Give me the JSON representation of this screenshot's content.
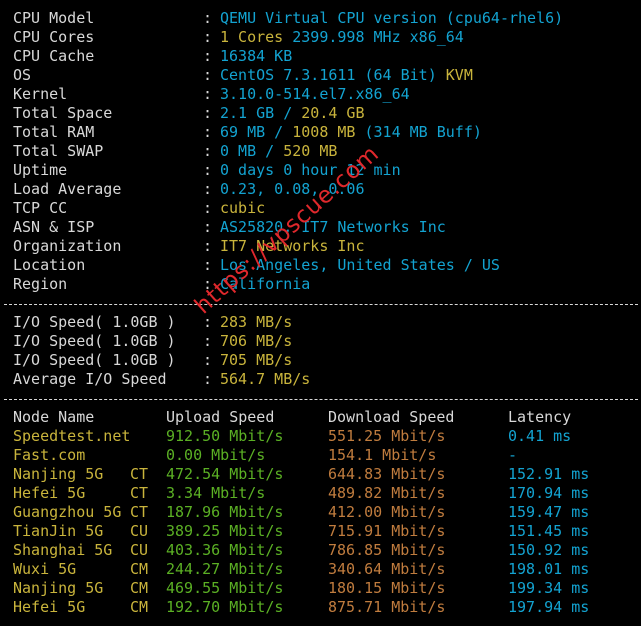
{
  "system": {
    "cpu_model": {
      "label": "CPU Model",
      "value": "QEMU Virtual CPU version (cpu64-rhel6)"
    },
    "cpu_cores": {
      "label": "CPU Cores",
      "count": "1 Cores",
      "freq": "2399.998 MHz x86_64"
    },
    "cpu_cache": {
      "label": "CPU Cache",
      "value": "16384 KB"
    },
    "os": {
      "label": "OS",
      "value": "CentOS 7.3.1611 (64 Bit)",
      "virt": "KVM"
    },
    "kernel": {
      "label": "Kernel",
      "value": "3.10.0-514.el7.x86_64"
    },
    "total_space": {
      "label": "Total Space",
      "used": "2.1 GB",
      "sep": " / ",
      "total": "20.4 GB"
    },
    "total_ram": {
      "label": "Total RAM",
      "used": "69 MB",
      "sep": " / ",
      "total": "1008 MB",
      "buff": "(314 MB Buff)"
    },
    "total_swap": {
      "label": "Total SWAP",
      "used": "0 MB",
      "sep": " / ",
      "total": "520 MB"
    },
    "uptime": {
      "label": "Uptime",
      "value": "0 days 0 hour 12 min"
    },
    "load_average": {
      "label": "Load Average",
      "value": "0.23, 0.08, 0.06"
    },
    "tcp_cc": {
      "label": "TCP CC",
      "value": "cubic"
    },
    "asn_isp": {
      "label": "ASN & ISP",
      "value": "AS25820, IT7 Networks Inc"
    },
    "organization": {
      "label": "Organization",
      "value": "IT7 Networks Inc"
    },
    "location": {
      "label": "Location",
      "value": "Los Angeles, United States / US"
    },
    "region": {
      "label": "Region",
      "value": "California"
    }
  },
  "colon": ":",
  "separator": "----------------------------------------------------------------------",
  "io": {
    "runs": [
      {
        "label": "I/O Speed( 1.0GB )",
        "value": "283 MB/s"
      },
      {
        "label": "I/O Speed( 1.0GB )",
        "value": "706 MB/s"
      },
      {
        "label": "I/O Speed( 1.0GB )",
        "value": "705 MB/s"
      }
    ],
    "average": {
      "label": "Average I/O Speed",
      "value": "564.7 MB/s"
    }
  },
  "speedtest": {
    "headers": {
      "node": "Node Name",
      "upload": "Upload Speed",
      "download": "Download Speed",
      "latency": "Latency"
    },
    "rows": [
      {
        "node": "Speedtest.net",
        "isp": "",
        "upload": "912.50 Mbit/s",
        "download": "551.25 Mbit/s",
        "latency": "0.41 ms"
      },
      {
        "node": "Fast.com",
        "isp": "",
        "upload": "0.00 Mbit/s",
        "download": "154.1 Mbit/s",
        "latency": "-"
      },
      {
        "node": "Nanjing 5G",
        "isp": "CT",
        "upload": "472.54 Mbit/s",
        "download": "644.83 Mbit/s",
        "latency": "152.91 ms"
      },
      {
        "node": "Hefei 5G",
        "isp": "CT",
        "upload": "3.34 Mbit/s",
        "download": "489.82 Mbit/s",
        "latency": "170.94 ms"
      },
      {
        "node": "Guangzhou 5G",
        "isp": "CT",
        "upload": "187.96 Mbit/s",
        "download": "412.00 Mbit/s",
        "latency": "159.47 ms"
      },
      {
        "node": "TianJin 5G",
        "isp": "CU",
        "upload": "389.25 Mbit/s",
        "download": "715.91 Mbit/s",
        "latency": "151.45 ms"
      },
      {
        "node": "Shanghai 5G",
        "isp": "CU",
        "upload": "403.36 Mbit/s",
        "download": "786.85 Mbit/s",
        "latency": "150.92 ms"
      },
      {
        "node": "Wuxi 5G",
        "isp": "CM",
        "upload": "244.27 Mbit/s",
        "download": "340.64 Mbit/s",
        "latency": "198.01 ms"
      },
      {
        "node": "Nanjing 5G",
        "isp": "CM",
        "upload": "469.55 Mbit/s",
        "download": "180.15 Mbit/s",
        "latency": "199.34 ms"
      },
      {
        "node": "Hefei 5G",
        "isp": "CM",
        "upload": "192.70 Mbit/s",
        "download": "875.71 Mbit/s",
        "latency": "197.94 ms"
      }
    ]
  },
  "watermark": "https://vpscue.com",
  "colors": {
    "cyan": "#13a3d1",
    "olive": "#c9b43c",
    "green": "#5bb024",
    "orange": "#c07c3e",
    "watermark": "#e0282c"
  }
}
